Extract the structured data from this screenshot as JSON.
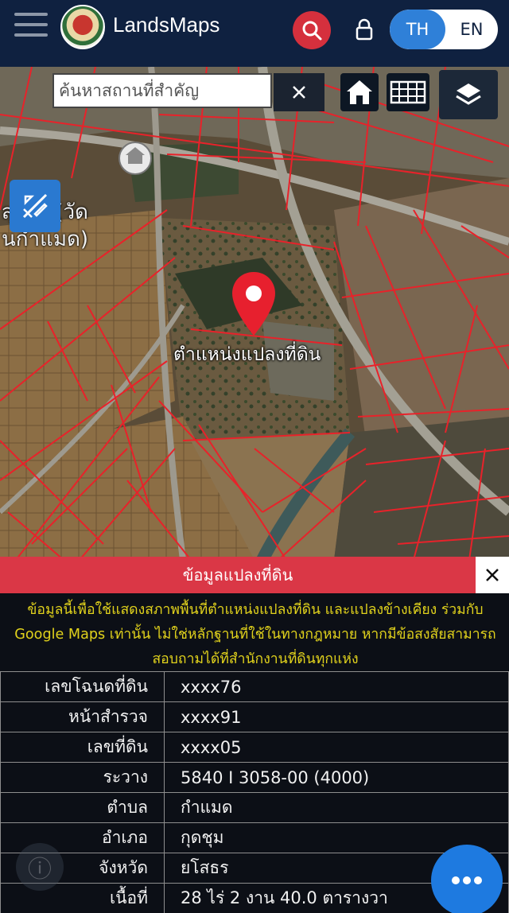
{
  "header": {
    "title": "LandsMaps",
    "lang": {
      "th": "TH",
      "en": "EN"
    }
  },
  "search": {
    "placeholder": "ค้นหาสถานที่สำคัญ"
  },
  "map": {
    "poi_label_line1": "สุริโย (วัด",
    "poi_label_line2": "นกำแมด)",
    "marker_label": "ตำแหน่งแปลงที่ดิน"
  },
  "panel": {
    "title": "ข้อมูลแปลงที่ดิน",
    "disclaimer": "ข้อมูลนี้เพื่อใช้แสดงสภาพพื้นที่ตำแหน่งแปลงที่ดิน และแปลงข้างเคียง ร่วมกับ Google Maps เท่านั้น ไม่ใช่หลักฐานที่ใช้ในทางกฎหมาย หากมีข้อสงสัยสามารถสอบถามได้ที่สำนักงานที่ดินทุกแห่ง",
    "rows": [
      {
        "key": "เลขโฉนดที่ดิน",
        "value": "xxxx76"
      },
      {
        "key": "หน้าสำรวจ",
        "value": "xxxx91"
      },
      {
        "key": "เลขที่ดิน",
        "value": "xxxx05"
      },
      {
        "key": "ระวาง",
        "value": "5840 I 3058-00 (4000)"
      },
      {
        "key": "ตำบล",
        "value": "กำแมด"
      },
      {
        "key": "อำเภอ",
        "value": "กุดชุม"
      },
      {
        "key": "จังหวัด",
        "value": "ยโสธร"
      },
      {
        "key": "เนื้อที่",
        "value": "28 ไร่ 2 งาน 40.0 ตารางวา"
      }
    ]
  },
  "colors": {
    "header_bg": "#0f2140",
    "accent_red": "#da3746",
    "accent_blue": "#2f80d8",
    "parcel_line": "#e8222a",
    "disclaimer_text": "#e1d21c"
  },
  "icons": [
    "menu-icon",
    "logo-emblem",
    "search-icon",
    "lock-icon",
    "close-icon",
    "home-icon",
    "grid-icon",
    "layers-icon",
    "measure-icon",
    "location-pin-icon",
    "info-icon",
    "more-icon"
  ]
}
